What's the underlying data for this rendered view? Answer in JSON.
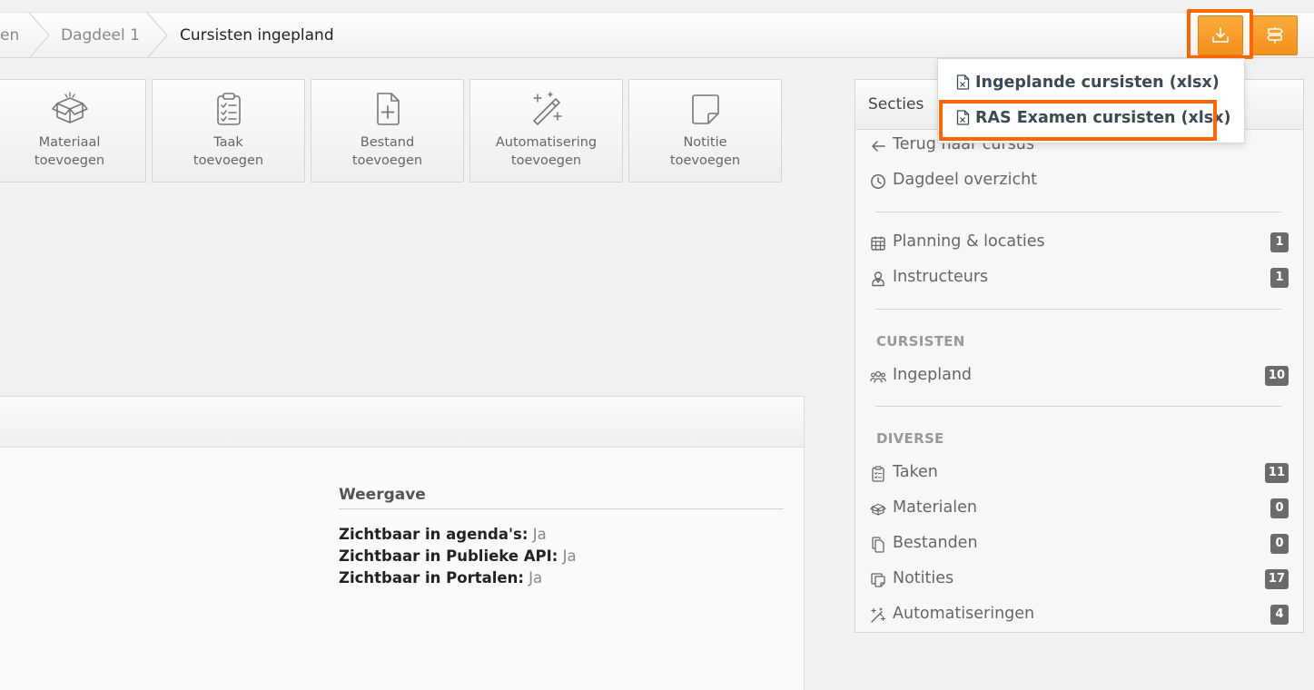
{
  "breadcrumb": {
    "items": [
      {
        "label": "en"
      },
      {
        "label": "Dagdeel 1"
      },
      {
        "label": "Cursisten ingepland"
      }
    ]
  },
  "toolbar": {
    "download_icon": "download-icon",
    "sections_icon": "signpost-icon",
    "accent_color": "#f7941d",
    "highlight_color": "#ff6600"
  },
  "download_menu": {
    "items": [
      {
        "label": "Ingeplande cursisten (xlsx)",
        "icon": "file-excel-icon"
      },
      {
        "label": "RAS Examen cursisten (xlsx)",
        "icon": "file-excel-icon"
      }
    ]
  },
  "tiles": [
    {
      "line1": "Materiaal",
      "line2": "toevoegen",
      "icon": "box-icon"
    },
    {
      "line1": "Taak",
      "line2": "toevoegen",
      "icon": "clipboard-check-icon"
    },
    {
      "line1": "Bestand",
      "line2": "toevoegen",
      "icon": "file-plus-icon"
    },
    {
      "line1": "Automatisering",
      "line2": "toevoegen",
      "icon": "magic-wand-icon"
    },
    {
      "line1": "Notitie",
      "line2": "toevoegen",
      "icon": "sticky-note-icon"
    }
  ],
  "weergave": {
    "title": "Weergave",
    "rows": [
      {
        "label": "Zichtbaar in agenda's:",
        "value": "Ja"
      },
      {
        "label": "Zichtbaar in Publieke API:",
        "value": "Ja"
      },
      {
        "label": "Zichtbaar in Portalen:",
        "value": "Ja"
      }
    ]
  },
  "sidebar": {
    "title": "Secties",
    "nav": [
      {
        "label": "Terug naar cursus",
        "icon": "arrow-left-icon"
      },
      {
        "label": "Dagdeel overzicht",
        "icon": "clock-icon"
      }
    ],
    "planning": [
      {
        "label": "Planning & locaties",
        "icon": "calendar-icon",
        "count": "1"
      },
      {
        "label": "Instructeurs",
        "icon": "instructor-icon",
        "count": "1"
      }
    ],
    "cursisten_title": "CURSISTEN",
    "cursisten": [
      {
        "label": "Ingepland",
        "icon": "users-icon",
        "count": "10"
      }
    ],
    "diverse_title": "DIVERSE",
    "diverse": [
      {
        "label": "Taken",
        "icon": "clipboard-icon",
        "count": "11"
      },
      {
        "label": "Materialen",
        "icon": "box-icon",
        "count": "0"
      },
      {
        "label": "Bestanden",
        "icon": "files-icon",
        "count": "0"
      },
      {
        "label": "Notities",
        "icon": "notes-icon",
        "count": "17"
      },
      {
        "label": "Automatiseringen",
        "icon": "magic-wand-icon",
        "count": "4"
      }
    ]
  }
}
